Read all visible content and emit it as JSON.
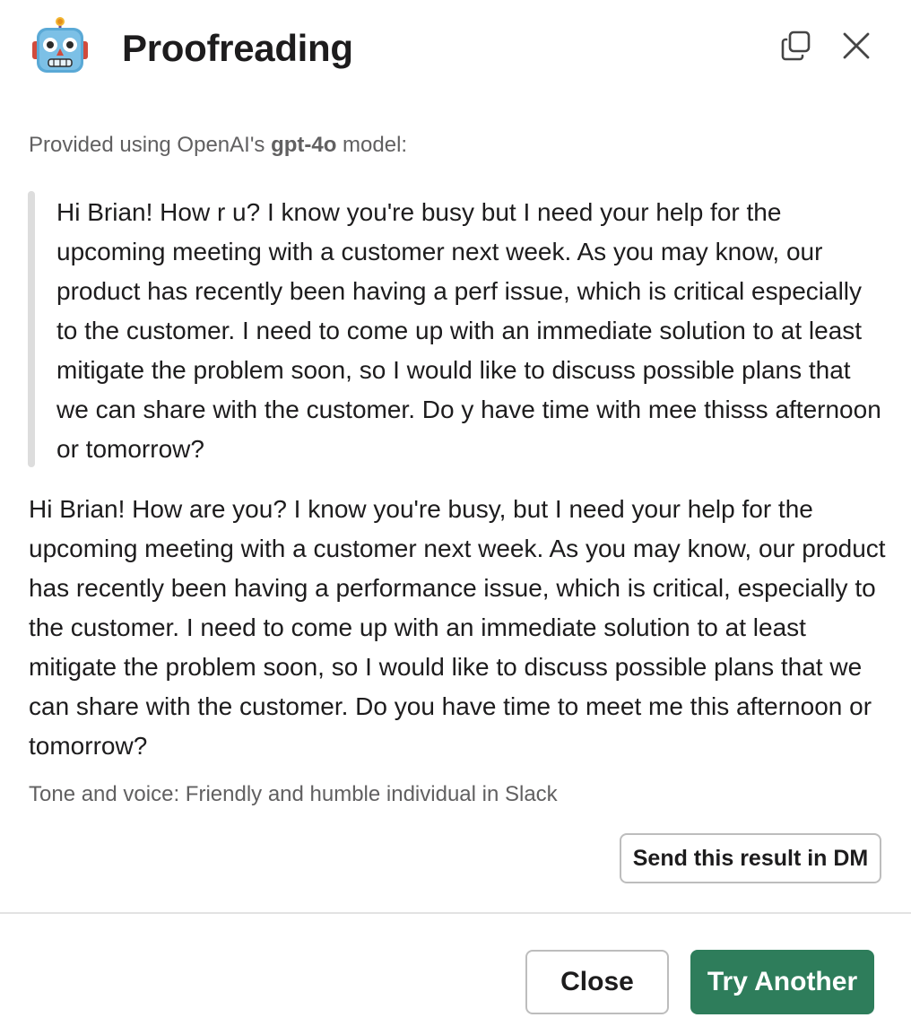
{
  "header": {
    "title": "Proofreading",
    "app_icon": "robot-face-icon",
    "popout_icon": "popout-icon",
    "close_icon": "close-icon"
  },
  "body": {
    "provided_prefix": "Provided using OpenAI's ",
    "provided_model": "gpt-4o",
    "provided_suffix": " model:",
    "original_text": "Hi Brian! How r u? I know you're busy but I need your help for the upcoming meeting with a customer next week. As you may know, our product has recently been having a perf issue, which is critical especially to the customer. I need to come up with an immediate solution to at least mitigate the problem soon, so I would like to discuss possible plans that we can share with the customer. Do y have time with mee thisss afternoon or tomorrow?",
    "result_text": "Hi Brian! How are you? I know you're busy, but I need your help for the upcoming meeting with a customer next week. As you may know, our product has recently been having a performance issue, which is critical, especially to the customer. I need to come up with an immediate solution to at least mitigate the problem soon, so I would like to discuss possible plans that we can share with the customer. Do you have time to meet me this afternoon or tomorrow?",
    "tone": "Tone and voice: Friendly and humble individual in Slack",
    "send_dm_label": "Send this result in DM"
  },
  "footer": {
    "close_label": "Close",
    "try_another_label": "Try Another"
  },
  "colors": {
    "primary_button": "#2e7d5b",
    "quote_bar": "#dddddd",
    "muted_text": "#616061"
  }
}
